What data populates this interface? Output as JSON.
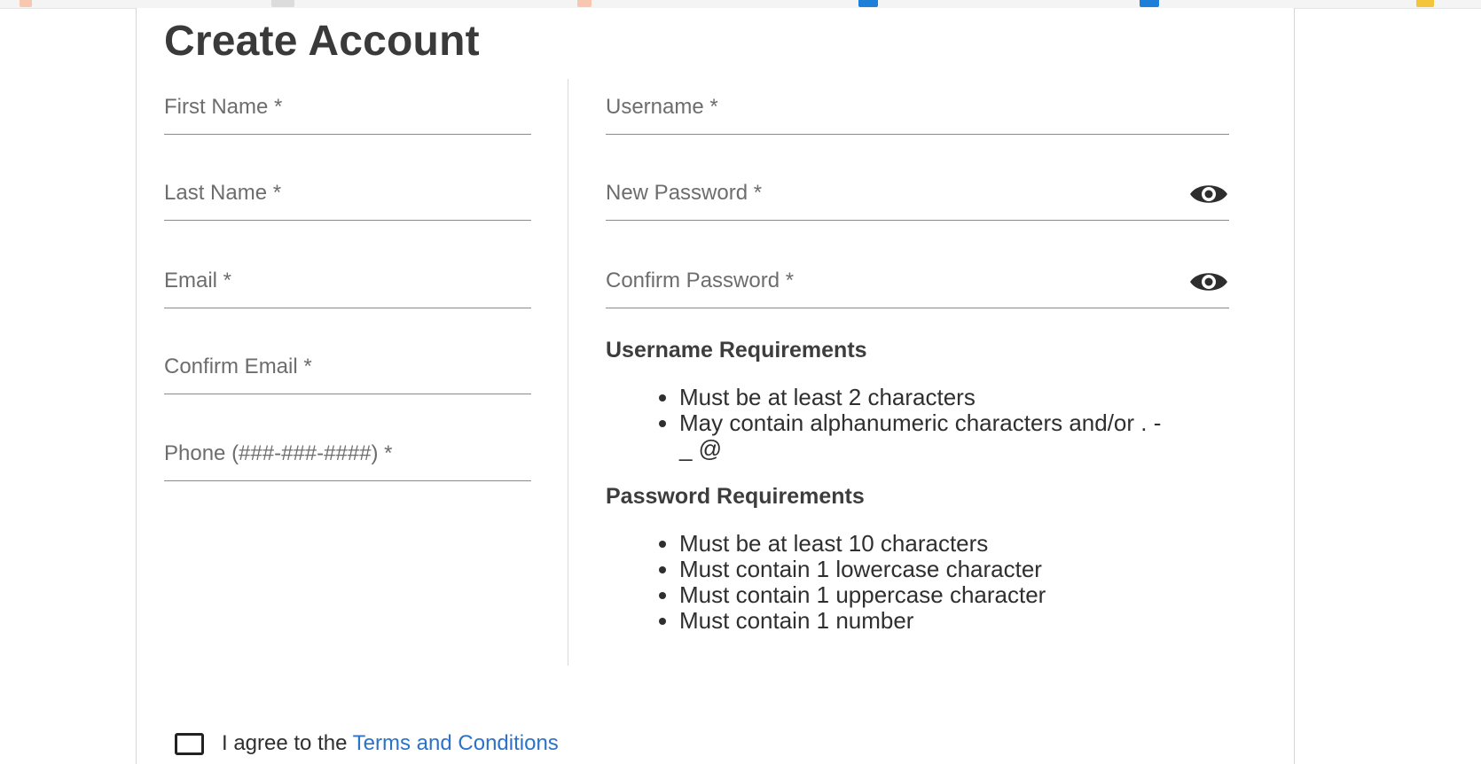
{
  "page": {
    "title": "Create Account"
  },
  "left_fields": [
    {
      "label": "First Name *"
    },
    {
      "label": "Last Name *"
    },
    {
      "label": "Email *"
    },
    {
      "label": "Confirm Email *"
    },
    {
      "label": "Phone (###-###-####) *"
    }
  ],
  "right_fields": {
    "username": {
      "label": "Username *"
    },
    "new_password": {
      "label": "New Password *",
      "toggle_icon": "eye-icon"
    },
    "confirm_password": {
      "label": "Confirm Password *",
      "toggle_icon": "eye-icon"
    }
  },
  "username_requirements": {
    "heading": "Username Requirements",
    "items": [
      "Must be at least 2 characters",
      "May contain alphanumeric characters and/or . - _ @"
    ]
  },
  "password_requirements": {
    "heading": "Password Requirements",
    "items": [
      "Must be at least 10 characters",
      "Must contain 1 lowercase character",
      "Must contain 1 uppercase character",
      "Must contain 1 number"
    ]
  },
  "agreement": {
    "prefix": "I agree to the",
    "link_text": "Terms and Conditions",
    "checked": false
  },
  "colors": {
    "link": "#2b73c8",
    "text": "#2f2f2f",
    "label": "#6d6d6d"
  }
}
